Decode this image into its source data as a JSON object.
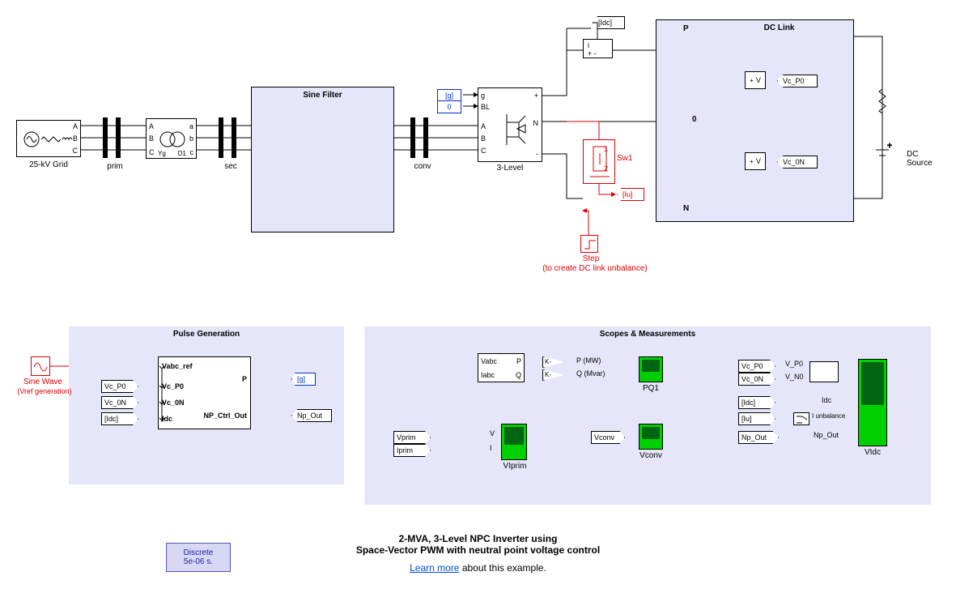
{
  "grid": {
    "label": "25-kV Grid",
    "p1": "A",
    "p2": "B",
    "p3": "C"
  },
  "busPrim": "prim",
  "busSec": "sec",
  "busConv": "conv",
  "transformer": {
    "left": [
      "A",
      "B",
      "C"
    ],
    "right": [
      "a",
      "b",
      "c"
    ],
    "core": "Yg",
    "d": "D1"
  },
  "sineFilter": {
    "title": "Sine Filter"
  },
  "threeLevel": {
    "label": "3-Level",
    "ports": [
      "g",
      "BL",
      "A",
      "B",
      "C"
    ],
    "plus": "+",
    "neutral": "N",
    "minus": "-"
  },
  "inTags": {
    "g": "[g]",
    "zero": "0"
  },
  "sw": {
    "name": "Sw1"
  },
  "step": {
    "name": "Step",
    "note": "(to create DC link unbalance)"
  },
  "iu": "[Iu]",
  "idc": "[Idc]",
  "dclink": {
    "title": "DC Link",
    "p": "P",
    "zero": "0",
    "n": "N",
    "vcP0": "Vc_P0",
    "vc0N": "Vc_0N",
    "vmeas": "V"
  },
  "dcsrc": "DC\nSource",
  "pulseGen": {
    "title": "Pulse Generation",
    "in": [
      "Vabc_ref",
      "Vc_P0",
      "Vc_0N",
      "Idc"
    ],
    "out": [
      "P",
      "NP_Ctrl_Out"
    ],
    "from": [
      "Vc_P0",
      "Vc_0N",
      "[Idc]"
    ],
    "gotoP": "[g]",
    "gotoNP": "Np_Out"
  },
  "sinewave": {
    "name": "Sine Wave",
    "note": "(Vref generation)"
  },
  "scopes": {
    "title": "Scopes & Measurements",
    "meas": {
      "ports": [
        "Vabc",
        "Iabc",
        "P",
        "Q"
      ],
      "pLabel": "P (MW)",
      "qLabel": "Q (Mvar)"
    },
    "vprim": "Vprim",
    "iprim": "Iprim",
    "v": "V",
    "i": "I",
    "pq1": "PQ1",
    "vconv": "Vconv",
    "vlprim": "VIprim",
    "right": {
      "from": [
        "Vc_P0",
        "Vc_0N",
        "[Idc]",
        "[Iu]",
        "Np_Out"
      ],
      "labels": [
        "V_P0",
        "V_N0",
        "Idc",
        "I unbalance",
        "Np_Out"
      ],
      "scope": "VIdc"
    },
    "gainK": "K-"
  },
  "powergui": {
    "l1": "Discrete",
    "l2": "5e-06 s."
  },
  "footer": {
    "l1": "2-MVA, 3-Level NPC Inverter using",
    "l2": "Space-Vector PWM with neutral point voltage control",
    "link": "Learn more",
    "rest": " about this example."
  }
}
